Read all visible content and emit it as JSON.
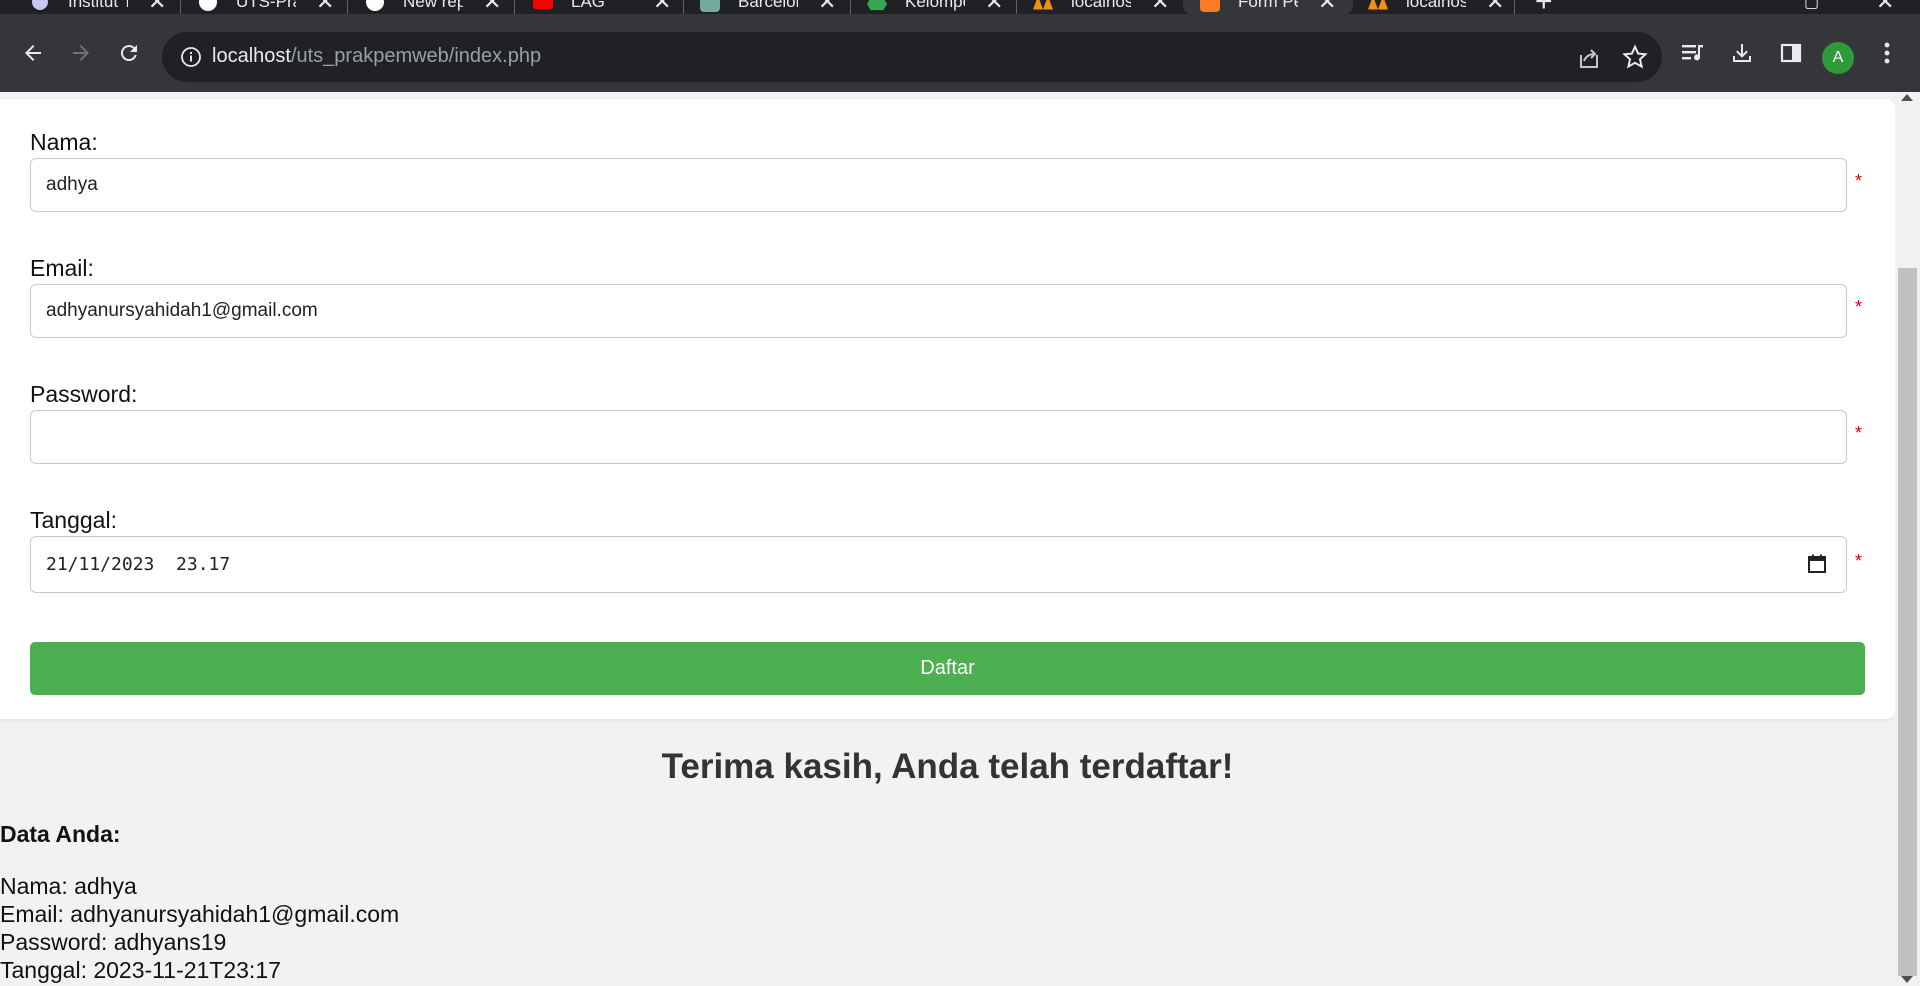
{
  "browser": {
    "tabs": [
      {
        "title": "Institut T",
        "icon": "university-icon"
      },
      {
        "title": "UTS-Prak",
        "icon": "github-icon"
      },
      {
        "title": "New rep",
        "icon": "github-icon"
      },
      {
        "title": "LAG",
        "icon": "youtube-icon"
      },
      {
        "title": "Barcelon",
        "icon": "chatgpt-icon"
      },
      {
        "title": "Kelompo",
        "icon": "google-drive-icon"
      },
      {
        "title": "localhost",
        "icon": "phpmyadmin-icon"
      },
      {
        "title": "Form Pe",
        "icon": "xampp-icon"
      },
      {
        "title": "localhost",
        "icon": "phpmyadmin-icon"
      }
    ],
    "address": {
      "host": "localhost",
      "path": "/uts_prakpemweb/index.php"
    },
    "profile_initial": "A"
  },
  "form": {
    "nama_label": "Nama:",
    "nama_value": "adhya",
    "email_label": "Email:",
    "email_value": "adhyanursyahidah1@gmail.com",
    "password_label": "Password:",
    "password_value": "",
    "tanggal_label": "Tanggal:",
    "tanggal_value": "21/11/2023  23.17",
    "required_mark": "*",
    "submit_label": "Daftar"
  },
  "result": {
    "heading": "Terima kasih, Anda telah terdaftar!",
    "data_title": "Data Anda:",
    "lines": [
      "Nama: adhya",
      "Email: adhyanursyahidah1@gmail.com",
      "Password: adhyans19",
      "Tanggal: 2023-11-21T23:17"
    ]
  },
  "colors": {
    "button_green": "#4caf50",
    "required_red": "#e00000",
    "avatar_green": "#2e9a3a"
  }
}
